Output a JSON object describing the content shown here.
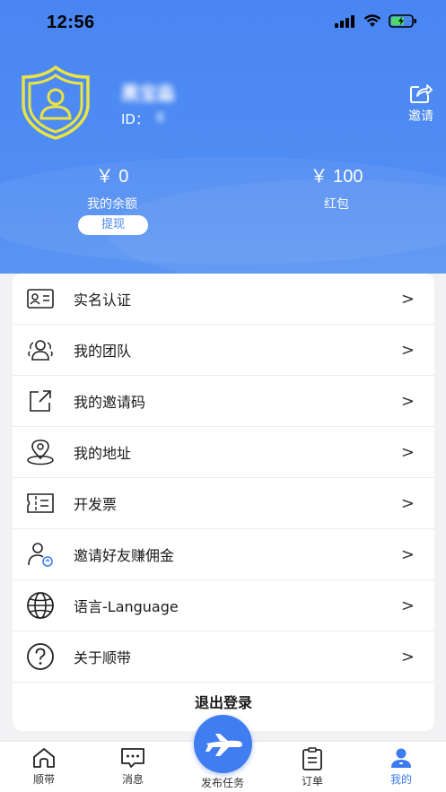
{
  "status_bar": {
    "time": "12:56"
  },
  "profile": {
    "username": "黑宝淼",
    "id_label": "ID：",
    "id_value": "6",
    "invite_label": "邀请"
  },
  "balance": {
    "amount": "￥ 0",
    "amount_label": "我的余额",
    "withdraw_label": "提现",
    "red_packet": "￥ 100",
    "red_packet_label": "红包"
  },
  "menu": {
    "items": [
      {
        "label": "实名认证",
        "icon": "id-card-icon"
      },
      {
        "label": "我的团队",
        "icon": "team-icon"
      },
      {
        "label": "我的邀请码",
        "icon": "share-icon"
      },
      {
        "label": "我的地址",
        "icon": "location-icon"
      },
      {
        "label": "开发票",
        "icon": "invoice-icon"
      },
      {
        "label": "邀请好友赚佣金",
        "icon": "invite-friend-icon"
      },
      {
        "label": "语言-Language",
        "icon": "globe-icon"
      },
      {
        "label": "关于顺带",
        "icon": "help-icon"
      }
    ],
    "chevron": ">",
    "logout_label": "退出登录"
  },
  "tabbar": {
    "tabs": [
      {
        "label": "顺带",
        "icon": "home-icon"
      },
      {
        "label": "消息",
        "icon": "message-icon"
      },
      {
        "label": "发布任务",
        "icon": "plane-icon"
      },
      {
        "label": "订单",
        "icon": "order-icon"
      },
      {
        "label": "我的",
        "icon": "user-icon"
      }
    ]
  },
  "colors": {
    "primary": "#4a86f2",
    "accent_yellow": "#e9e443",
    "active_tab": "#3d7bf0"
  }
}
